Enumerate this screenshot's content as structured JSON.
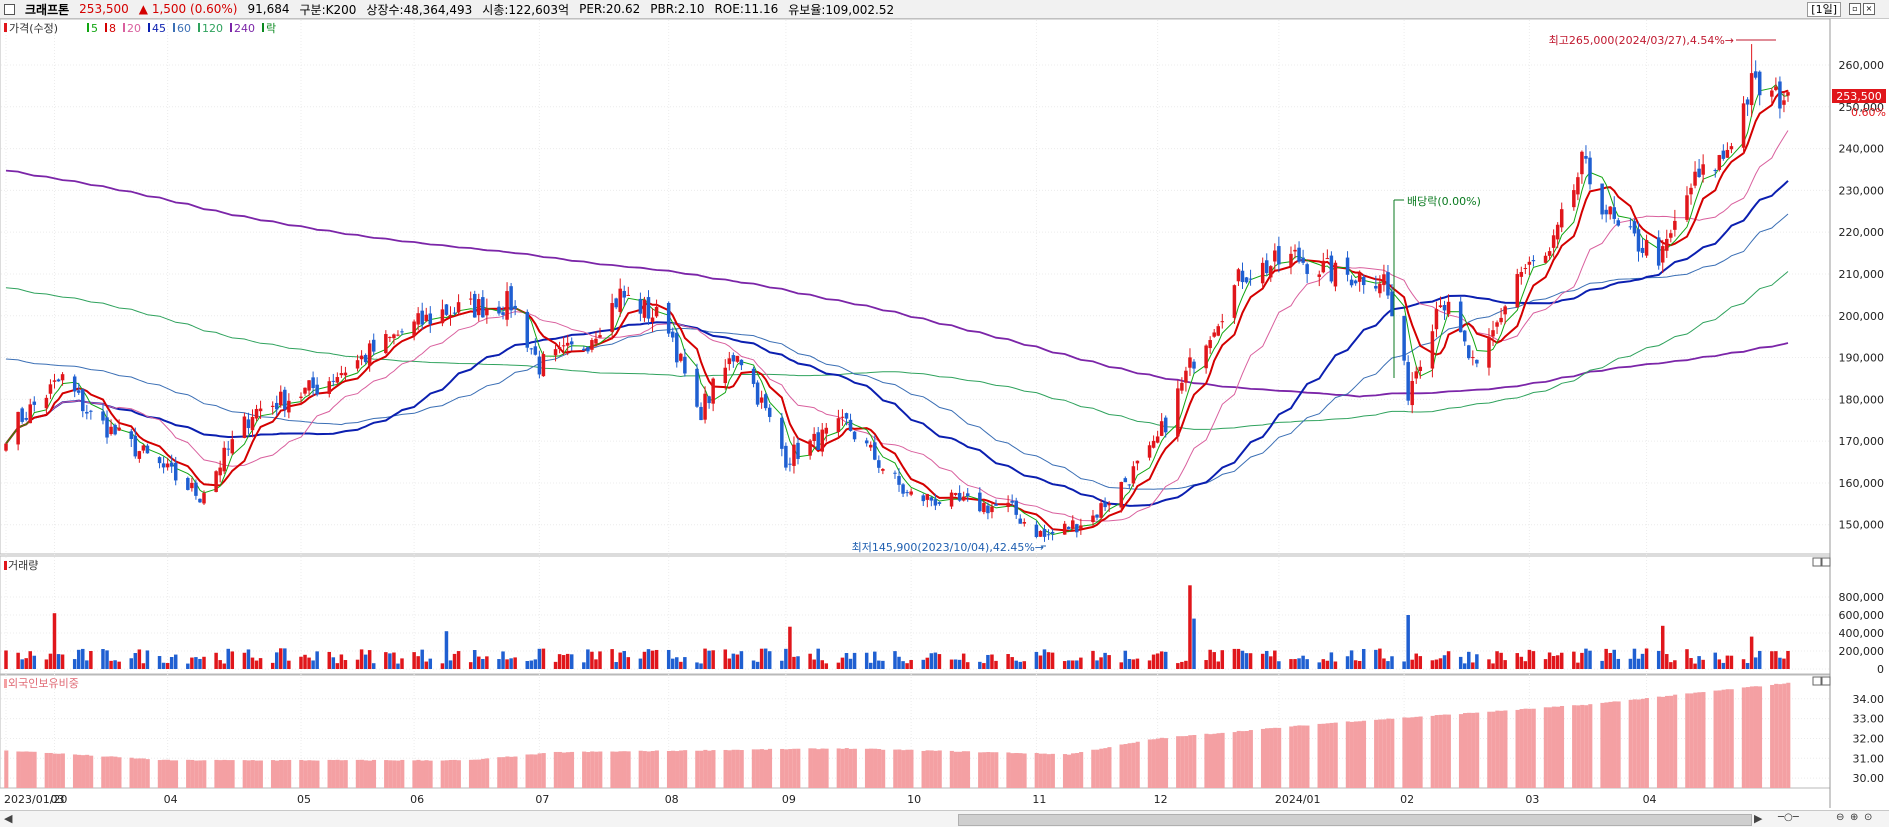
{
  "header": {
    "name": "크래프톤",
    "price": "253,500",
    "change": "▲ 1,500 (0.60%)",
    "volume": "91,684",
    "category": "구분:K200",
    "shares": "상장수:48,364,493",
    "market_cap": "시총:122,603억",
    "per": "PER:20.62",
    "pbr": "PBR:2.10",
    "roe": "ROE:11.16",
    "float": "유보율:109,002.52",
    "period": "[1일]"
  },
  "colors": {
    "up": "#e0161b",
    "down": "#1f5fd1",
    "ma5": "#d40000",
    "ma20": "#d9609e",
    "ma45": "#0b1fb0",
    "ma60": "#3b6fb5",
    "ma120": "#2fa25d",
    "ma240": "#7b25a8",
    "foreign": "#f4a0a3"
  },
  "legend": {
    "price": "가격(수정)",
    "items": [
      {
        "label": "5",
        "color": "#11a511"
      },
      {
        "label": "8",
        "color": "#d40000"
      },
      {
        "label": "20",
        "color": "#d9609e"
      },
      {
        "label": "45",
        "color": "#0b1fb0"
      },
      {
        "label": "60",
        "color": "#3b6fb5"
      },
      {
        "label": "120",
        "color": "#2fa25d"
      },
      {
        "label": "240",
        "color": "#7b25a8"
      },
      {
        "label": "락",
        "color": "#0a8a1f"
      }
    ]
  },
  "annotations": {
    "high": "최고265,000(2024/03/27),4.54%→",
    "low": "최저145,900(2023/10/04),42.45%→",
    "dividend": "배당락(0.00%)",
    "last_price": "253,500",
    "last_pct": "0.60%"
  },
  "panels": {
    "volume": "거래량",
    "foreign": "외국인보유비중"
  },
  "chart_data": {
    "type": "candlestick",
    "x_ticks": [
      "2023/01/20",
      "03",
      "04",
      "05",
      "06",
      "07",
      "08",
      "09",
      "10",
      "11",
      "12",
      "2024/01",
      "02",
      "03",
      "04"
    ],
    "price_axis": {
      "ticks": [
        "150,000",
        "160,000",
        "170,000",
        "180,000",
        "190,000",
        "200,000",
        "210,000",
        "220,000",
        "230,000",
        "240,000",
        "250,000",
        "260,000"
      ],
      "ylim": [
        143000,
        271000
      ]
    },
    "volume_axis": {
      "ticks": [
        "0",
        "200,000",
        "400,000",
        "600,000",
        "800,000"
      ],
      "ylim": [
        0,
        1000000
      ]
    },
    "foreign_axis": {
      "ticks": [
        "30.00",
        "31.00",
        "32.00",
        "33.00",
        "34.00"
      ],
      "ylim": [
        29.5,
        35.2
      ]
    },
    "price_anchors": [
      {
        "date": "2023/01/20",
        "value": 172000
      },
      {
        "date": "2023/02/03",
        "value": 185000
      },
      {
        "date": "2023/02/10",
        "value": 176000
      },
      {
        "date": "2023/03/09",
        "value": 157000
      },
      {
        "date": "2023/03/22",
        "value": 177000
      },
      {
        "date": "2023/04/07",
        "value": 183000
      },
      {
        "date": "2023/04/28",
        "value": 196000
      },
      {
        "date": "2023/05/08",
        "value": 201000
      },
      {
        "date": "2023/05/25",
        "value": 203000
      },
      {
        "date": "2023/06/01",
        "value": 188000
      },
      {
        "date": "2023/06/12",
        "value": 193000
      },
      {
        "date": "2023/06/21",
        "value": 205000
      },
      {
        "date": "2023/07/03",
        "value": 198000
      },
      {
        "date": "2023/07/10",
        "value": 176000
      },
      {
        "date": "2023/07/20",
        "value": 192000
      },
      {
        "date": "2023/08/01",
        "value": 166000
      },
      {
        "date": "2023/08/16",
        "value": 174000
      },
      {
        "date": "2023/08/31",
        "value": 157000
      },
      {
        "date": "2023/09/14",
        "value": 155000
      },
      {
        "date": "2023/09/25",
        "value": 154000
      },
      {
        "date": "2023/10/04",
        "value": 147000
      },
      {
        "date": "2023/10/16",
        "value": 152000
      },
      {
        "date": "2023/10/31",
        "value": 168000
      },
      {
        "date": "2023/11/10",
        "value": 190000
      },
      {
        "date": "2023/11/22",
        "value": 210000
      },
      {
        "date": "2023/12/05",
        "value": 214000
      },
      {
        "date": "2023/12/15",
        "value": 210000
      },
      {
        "date": "2023/12/27",
        "value": 209000
      },
      {
        "date": "2024/01/02",
        "value": 182000
      },
      {
        "date": "2024/01/10",
        "value": 205000
      },
      {
        "date": "2024/01/19",
        "value": 186000
      },
      {
        "date": "2024/01/29",
        "value": 210000
      },
      {
        "date": "2024/02/06",
        "value": 214000
      },
      {
        "date": "2024/02/14",
        "value": 236000
      },
      {
        "date": "2024/02/23",
        "value": 220000
      },
      {
        "date": "2024/03/05",
        "value": 214000
      },
      {
        "date": "2024/03/12",
        "value": 231000
      },
      {
        "date": "2024/03/20",
        "value": 238000
      },
      {
        "date": "2024/03/27",
        "value": 255000
      },
      {
        "date": "2024/04/02",
        "value": 252000
      },
      {
        "date": "2024/04/05",
        "value": 253500
      }
    ],
    "foreign_anchors": [
      {
        "date": "2023/01/20",
        "value": 31.4
      },
      {
        "date": "2023/03/01",
        "value": 30.9
      },
      {
        "date": "2023/05/15",
        "value": 30.9
      },
      {
        "date": "2023/06/05",
        "value": 31.3
      },
      {
        "date": "2023/08/15",
        "value": 31.5
      },
      {
        "date": "2023/10/10",
        "value": 31.2
      },
      {
        "date": "2023/11/01",
        "value": 32.0
      },
      {
        "date": "2023/12/15",
        "value": 32.8
      },
      {
        "date": "2024/02/15",
        "value": 33.7
      },
      {
        "date": "2024/04/05",
        "value": 34.8
      }
    ],
    "volume_spikes": [
      {
        "date": "2023/02/01",
        "value": 620000
      },
      {
        "date": "2023/05/09",
        "value": 420000
      },
      {
        "date": "2023/08/02",
        "value": 470000
      },
      {
        "date": "2023/11/09",
        "value": 930000
      },
      {
        "date": "2023/11/10",
        "value": 560000
      },
      {
        "date": "2024/01/02",
        "value": 600000
      },
      {
        "date": "2024/03/05",
        "value": 480000
      },
      {
        "date": "2024/03/27",
        "value": 360000
      }
    ],
    "high": {
      "date": "2024/03/27",
      "value": 265000
    },
    "low": {
      "date": "2023/10/04",
      "value": 145900
    },
    "last": 253500
  }
}
